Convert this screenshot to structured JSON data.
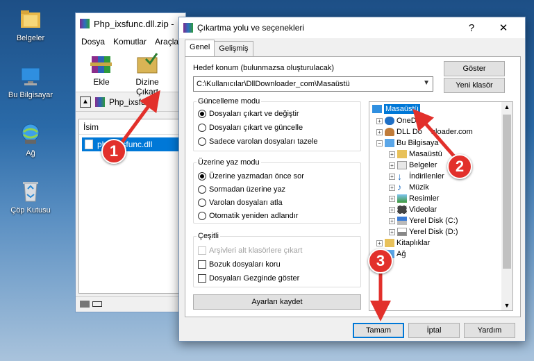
{
  "desktop": {
    "icons": [
      {
        "label": "Belgeler"
      },
      {
        "label": "Bu Bilgisayar"
      },
      {
        "label": "Ağ"
      },
      {
        "label": "Çöp Kutusu"
      }
    ]
  },
  "winrar": {
    "title": "Php_ixsfunc.dll.zip -",
    "menu": [
      "Dosya",
      "Komutlar",
      "Araçla"
    ],
    "toolbar": {
      "add_label": "Ekle",
      "extract_label": "Dizine Çıkart"
    },
    "path_text": "Php_ixsfunc",
    "column_name": "İsim",
    "file_name": "php_ixsfunc.dll"
  },
  "dialog": {
    "title": "Çıkartma yolu ve seçenekleri",
    "help_glyph": "?",
    "close_glyph": "✕",
    "tabs": [
      "Genel",
      "Gelişmiş"
    ],
    "dest_label": "Hedef konum (bulunmazsa oluşturulacak)",
    "dest_value": "C:\\Kullanıcılar\\DllDownloader_com\\Masaüstü",
    "show_button": "Göster",
    "new_folder_button": "Yeni klasör",
    "update_mode": {
      "title": "Güncelleme modu",
      "options": [
        "Dosyaları çıkart ve değiştir",
        "Dosyaları çıkart ve güncelle",
        "Sadece varolan dosyaları tazele"
      ],
      "selected": 0
    },
    "overwrite_mode": {
      "title": "Üzerine yaz modu",
      "options": [
        "Üzerine yazmadan önce sor",
        "Sormadan üzerine yaz",
        "Varolan dosyaları atla",
        "Otomatik yeniden adlandır"
      ],
      "selected": 0
    },
    "misc": {
      "title": "Çeşitli",
      "options": [
        "Arşivleri alt klasörlere çıkart",
        "Bozuk dosyaları koru",
        "Dosyaları Gezginde göster"
      ],
      "disabled_index": 0
    },
    "save_settings_button": "Ayarları kaydet",
    "tree": {
      "root": "Masaüstü",
      "items": [
        "OneD",
        "DLL Do",
        "nloader.com",
        "Bu Bilgisaya",
        "Masaüstü",
        "Belgeler",
        "İndirilenler",
        "Müzik",
        "Resimler",
        "Videolar",
        "Yerel Disk (C:)",
        "Yerel Disk (D:)",
        "Kitaplıklar",
        "Ağ"
      ]
    },
    "ok_button": "Tamam",
    "cancel_button": "İptal",
    "help_button": "Yardım"
  },
  "annotations": {
    "markers": [
      "1",
      "2",
      "3"
    ],
    "color": "#e2302b"
  }
}
